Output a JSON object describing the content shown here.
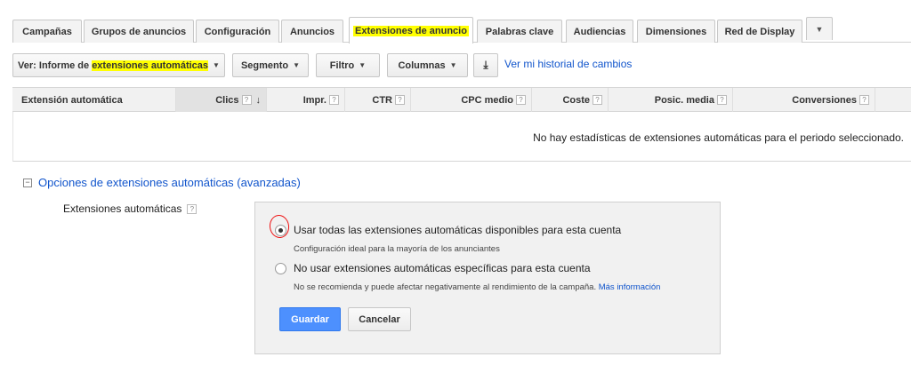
{
  "tabs": [
    {
      "label": "Campañas",
      "active": false
    },
    {
      "label": "Grupos de anuncios",
      "active": false
    },
    {
      "label": "Configuración",
      "active": false
    },
    {
      "label": "Anuncios",
      "active": false
    },
    {
      "label": "Extensiones de anuncio",
      "active": true
    },
    {
      "label": "Palabras clave",
      "active": false
    },
    {
      "label": "Audiencias",
      "active": false
    },
    {
      "label": "Dimensiones",
      "active": false
    },
    {
      "label": "Red de Display",
      "active": false
    }
  ],
  "tab_more_icon": "▼",
  "toolbar": {
    "view_prefix": "Ver: Informe de ",
    "view_highlight": "extensiones automáticas",
    "segment": "Segmento",
    "filter": "Filtro",
    "columns": "Columnas",
    "download_icon": "⤓",
    "history_link": "Ver mi historial de cambios",
    "caret": "▼"
  },
  "table": {
    "columns": [
      {
        "label": "Extensión automática",
        "help": false
      },
      {
        "label": "Clics",
        "help": true
      },
      {
        "label": "Impr.",
        "help": true
      },
      {
        "label": "CTR",
        "help": true
      },
      {
        "label": "CPC medio",
        "help": true
      },
      {
        "label": "Coste",
        "help": true
      },
      {
        "label": "Posic. media",
        "help": true
      },
      {
        "label": "Conversiones",
        "help": true
      }
    ],
    "sort_arrow": "↓",
    "help_mark": "?",
    "empty_message": "No hay estadísticas de extensiones automáticas para el periodo seleccionado."
  },
  "options": {
    "toggle_icon": "−",
    "toggle_label": "Opciones de extensiones automáticas (avanzadas)",
    "field_label": "Extensiones automáticas",
    "radio_use_all": "Usar todas las extensiones automáticas disponibles para esta cuenta",
    "radio_use_all_desc": "Configuración ideal para la mayoría de los anunciantes",
    "radio_no_use": "No usar extensiones automáticas específicas para esta cuenta",
    "radio_no_use_desc": "No se recomienda y puede afectar negativamente al rendimiento de la campaña.",
    "more_info": "Más información",
    "selected": "use_all",
    "save": "Guardar",
    "cancel": "Cancelar"
  },
  "colors": {
    "link": "#1155cc",
    "primary_button": "#4d90fe",
    "highlight": "#ffff00",
    "annotation": "#ee1111"
  }
}
